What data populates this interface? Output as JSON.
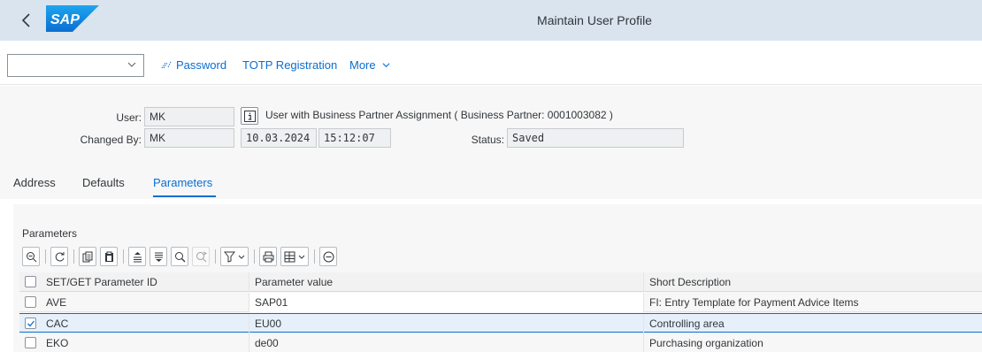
{
  "shell": {
    "title": "Maintain User Profile",
    "logo_text": "SAP"
  },
  "toolbar": {
    "dropdown_value": "",
    "password_label": "Password",
    "totp_label": "TOTP Registration",
    "more_label": "More"
  },
  "header": {
    "user_label": "User:",
    "user_value": "MK",
    "info_text": "User with Business Partner Assignment ( Business Partner: 0001003082 )",
    "changed_by_label": "Changed By:",
    "changed_by_value": "MK",
    "changed_date": "10.03.2024",
    "changed_time": "15:12:07",
    "status_label": "Status:",
    "status_value": "Saved"
  },
  "tabs": [
    {
      "label": "Address"
    },
    {
      "label": "Defaults"
    },
    {
      "label": "Parameters",
      "active": true
    }
  ],
  "parameters": {
    "section_title": "Parameters",
    "columns": [
      "SET/GET Parameter ID",
      "Parameter value",
      "Short Description"
    ],
    "rows": [
      {
        "id": "AVE",
        "value": "SAP01",
        "description": "FI: Entry Template for Payment Advice Items",
        "selected": false
      },
      {
        "id": "CAC",
        "value": "EU00",
        "description": "Controlling area",
        "selected": true
      },
      {
        "id": "EKO",
        "value": "de00",
        "description": "Purchasing organization",
        "selected": false
      }
    ]
  },
  "colors": {
    "accent": "#0a6ed1",
    "shell_bg": "#d9e4ef",
    "header_bg": "#f7f7f7",
    "selected_row": "#e5f0fa"
  }
}
